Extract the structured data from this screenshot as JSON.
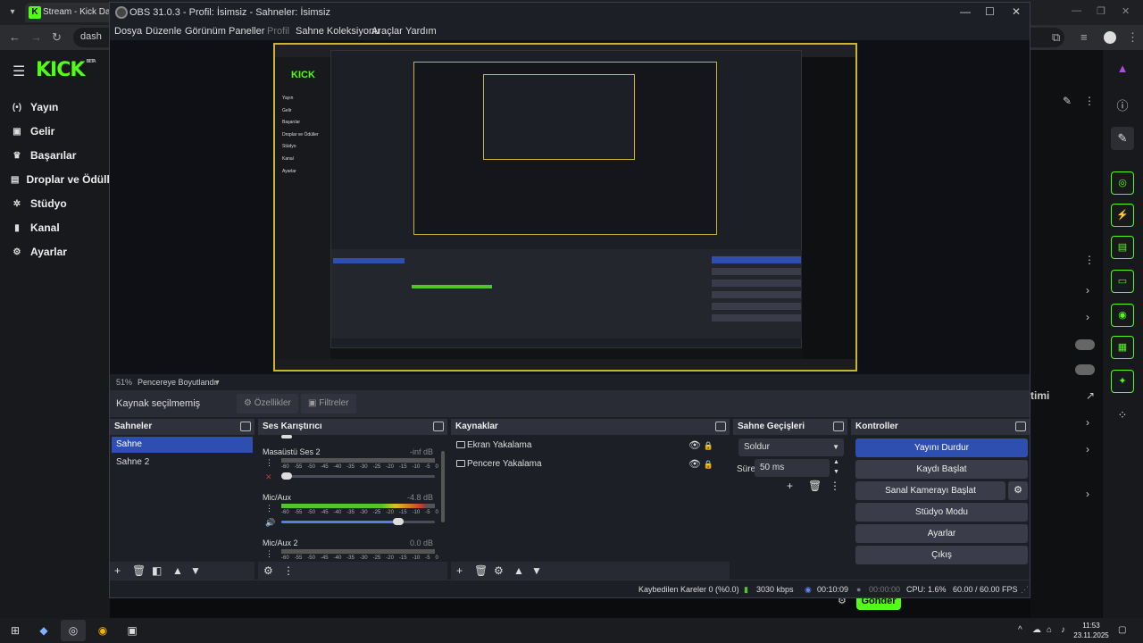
{
  "browser": {
    "tab_title": "Stream - Kick Dashb",
    "url_text": "dash",
    "kick": {
      "logo": "KICK",
      "logo_sup": "BETA",
      "nav": [
        {
          "label": "Yayın",
          "icon": "broadcast-icon"
        },
        {
          "label": "Gelir",
          "icon": "revenue-icon"
        },
        {
          "label": "Başarılar",
          "icon": "trophy-icon"
        },
        {
          "label": "Droplar ve Ödüller",
          "icon": "gift-icon"
        },
        {
          "label": "Stüdyo",
          "icon": "studio-icon"
        },
        {
          "label": "Kanal",
          "icon": "channel-icon"
        },
        {
          "label": "Ayarlar",
          "icon": "gear-icon"
        }
      ],
      "right_fragment": "timi",
      "send_button": "Gönder"
    }
  },
  "obs": {
    "title": "OBS 31.0.3 - Profil: İsimsiz - Sahneler: İsimsiz",
    "menu": [
      {
        "label": "Dosya",
        "enabled": true
      },
      {
        "label": "Düzenle",
        "enabled": true
      },
      {
        "label": "Görünüm",
        "enabled": true
      },
      {
        "label": "Paneller",
        "enabled": true
      },
      {
        "label": "Profil",
        "enabled": false
      },
      {
        "label": "Sahne Koleksiyonu",
        "enabled": true
      },
      {
        "label": "Araçlar",
        "enabled": true
      },
      {
        "label": "Yardım",
        "enabled": true
      }
    ],
    "zoom": {
      "percent": "51%",
      "label": "Pencereye Boyutlandır"
    },
    "context": {
      "label": "Kaynak seçilmemiş",
      "properties": "Özellikler",
      "filters": "Filtreler"
    },
    "scenes": {
      "title": "Sahneler",
      "items": [
        "Sahne",
        "Sahne 2"
      ],
      "selected": 0
    },
    "mixer": {
      "title": "Ses Karıştırıcı",
      "scale": [
        "-60",
        "-55",
        "-50",
        "-45",
        "-40",
        "-35",
        "-30",
        "-25",
        "-20",
        "-15",
        "-10",
        "-5",
        "0"
      ],
      "channels": [
        {
          "name": "Masaüstü Ses 2",
          "db": "-inf dB",
          "level": 0,
          "volume": 0.0,
          "muted": true
        },
        {
          "name": "Mic/Aux",
          "db": "-4.8 dB",
          "level": 0.93,
          "volume": 0.78,
          "muted": false
        },
        {
          "name": "Mic/Aux 2",
          "db": "0.0 dB",
          "level": 0,
          "volume": 1.0,
          "muted": false
        }
      ]
    },
    "sources": {
      "title": "Kaynaklar",
      "items": [
        "Ekran Yakalama",
        "Pencere Yakalama"
      ]
    },
    "transitions": {
      "title": "Sahne Geçişleri",
      "type": "Soldur",
      "duration_label": "Süre",
      "duration": "50 ms"
    },
    "controls": {
      "title": "Kontroller",
      "buttons": [
        "Yayını Durdur",
        "Kaydı Başlat",
        "Sanal Kamerayı Başlat",
        "Stüdyo Modu",
        "Ayarlar",
        "Çıkış"
      ]
    },
    "status": {
      "dropped": "Kaybedilen Kareler 0 (%0.0)",
      "bitrate": "3030 kbps",
      "stream_time": "00:10:09",
      "rec_time": "00:00:00",
      "cpu": "CPU: 1.6%",
      "fps": "60.00 / 60.00 FPS"
    }
  },
  "taskbar": {
    "time": "11:53",
    "date": "23.11.2025"
  },
  "colors": {
    "kick_green": "#53fc18",
    "obs_accent": "#2e4fb0",
    "preview_border": "#c9b52e"
  }
}
